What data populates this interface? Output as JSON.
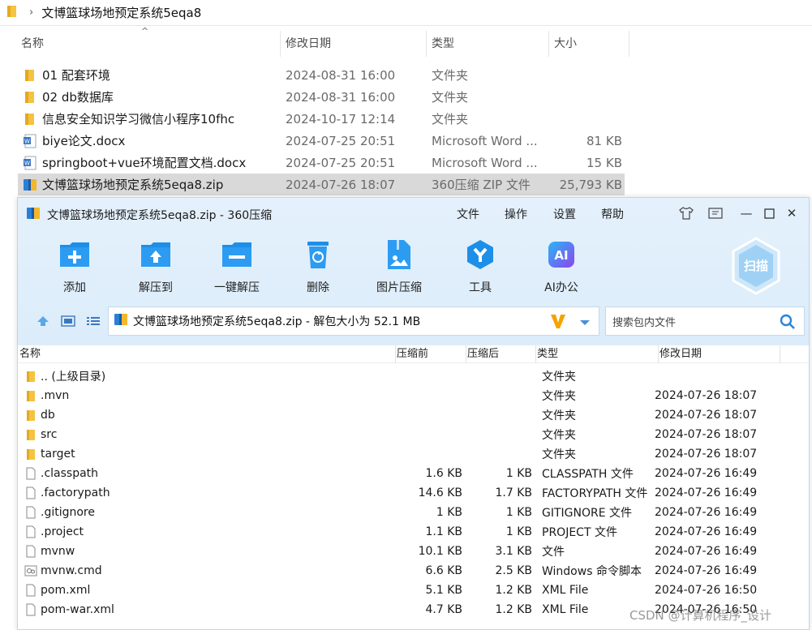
{
  "explorer": {
    "breadcrumb": "文博篮球场地预定系统5eqa8",
    "columns": {
      "name": "名称",
      "date": "修改日期",
      "type": "类型",
      "size": "大小"
    },
    "rows": [
      {
        "name": "01 配套环境",
        "date": "2024-08-31 16:00",
        "type": "文件夹",
        "size": "",
        "icon": "folder-icon"
      },
      {
        "name": "02 db数据库",
        "date": "2024-08-31 16:00",
        "type": "文件夹",
        "size": "",
        "icon": "folder-icon"
      },
      {
        "name": "信息安全知识学习微信小程序10fhc",
        "date": "2024-10-17 12:14",
        "type": "文件夹",
        "size": "",
        "icon": "folder-icon"
      },
      {
        "name": "biye论文.docx",
        "date": "2024-07-25 20:51",
        "type": "Microsoft Word ...",
        "size": "81 KB",
        "icon": "word-doc-icon"
      },
      {
        "name": "springboot+vue环境配置文档.docx",
        "date": "2024-07-25 20:51",
        "type": "Microsoft Word ...",
        "size": "15 KB",
        "icon": "word-doc-icon"
      },
      {
        "name": "文博篮球场地预定系统5eqa8.zip",
        "date": "2024-07-26 18:07",
        "type": "360压缩 ZIP 文件",
        "size": "25,793 KB",
        "icon": "zip-archive-icon"
      }
    ]
  },
  "zip": {
    "title": "文博篮球场地预定系统5eqa8.zip - 360压缩",
    "menu": [
      "文件",
      "操作",
      "设置",
      "帮助"
    ],
    "toolbar": [
      {
        "label": "添加",
        "icon": "add-icon"
      },
      {
        "label": "解压到",
        "icon": "extract-to-icon"
      },
      {
        "label": "一键解压",
        "icon": "one-click-extract-icon"
      },
      {
        "label": "删除",
        "icon": "delete-icon"
      },
      {
        "label": "图片压缩",
        "icon": "image-compress-icon"
      },
      {
        "label": "工具",
        "icon": "tools-icon"
      },
      {
        "label": "AI办公",
        "icon": "ai-office-icon"
      }
    ],
    "scan_label": "扫描",
    "address": "文博篮球场地预定系统5eqa8.zip - 解包大小为 52.1 MB",
    "search_placeholder": "搜索包内文件",
    "columns": {
      "name": "名称",
      "before": "压缩前",
      "after": "压缩后",
      "type": "类型",
      "date": "修改日期"
    },
    "rows": [
      {
        "name": ".. (上级目录)",
        "before": "",
        "after": "",
        "type": "文件夹",
        "date": "",
        "icon": "folder-icon"
      },
      {
        "name": ".mvn",
        "before": "",
        "after": "",
        "type": "文件夹",
        "date": "2024-07-26 18:07",
        "icon": "folder-icon"
      },
      {
        "name": "db",
        "before": "",
        "after": "",
        "type": "文件夹",
        "date": "2024-07-26 18:07",
        "icon": "folder-icon"
      },
      {
        "name": "src",
        "before": "",
        "after": "",
        "type": "文件夹",
        "date": "2024-07-26 18:07",
        "icon": "folder-icon"
      },
      {
        "name": "target",
        "before": "",
        "after": "",
        "type": "文件夹",
        "date": "2024-07-26 18:07",
        "icon": "folder-icon"
      },
      {
        "name": ".classpath",
        "before": "1.6 KB",
        "after": "1 KB",
        "type": "CLASSPATH 文件",
        "date": "2024-07-26 16:49",
        "icon": "file-icon"
      },
      {
        "name": ".factorypath",
        "before": "14.6 KB",
        "after": "1.7 KB",
        "type": "FACTORYPATH 文件",
        "date": "2024-07-26 16:49",
        "icon": "file-icon"
      },
      {
        "name": ".gitignore",
        "before": "1 KB",
        "after": "1 KB",
        "type": "GITIGNORE 文件",
        "date": "2024-07-26 16:49",
        "icon": "file-icon"
      },
      {
        "name": ".project",
        "before": "1.1 KB",
        "after": "1 KB",
        "type": "PROJECT 文件",
        "date": "2024-07-26 16:49",
        "icon": "file-icon"
      },
      {
        "name": "mvnw",
        "before": "10.1 KB",
        "after": "3.1 KB",
        "type": "文件",
        "date": "2024-07-26 16:49",
        "icon": "file-icon"
      },
      {
        "name": "mvnw.cmd",
        "before": "6.6 KB",
        "after": "2.5 KB",
        "type": "Windows 命令脚本",
        "date": "2024-07-26 16:49",
        "icon": "script-icon"
      },
      {
        "name": "pom.xml",
        "before": "5.1 KB",
        "after": "1.2 KB",
        "type": "XML File",
        "date": "2024-07-26 16:50",
        "icon": "file-icon"
      },
      {
        "name": "pom-war.xml",
        "before": "4.7 KB",
        "after": "1.2 KB",
        "type": "XML File",
        "date": "2024-07-26 16:50",
        "icon": "file-icon"
      }
    ]
  },
  "watermark": "CSDN @计算机程序_设计",
  "colors": {
    "accent": "#1e8fe8",
    "folder": "#f5c342",
    "selected_row": "#d9d9d9",
    "title_bg": "#e4f1fc"
  }
}
